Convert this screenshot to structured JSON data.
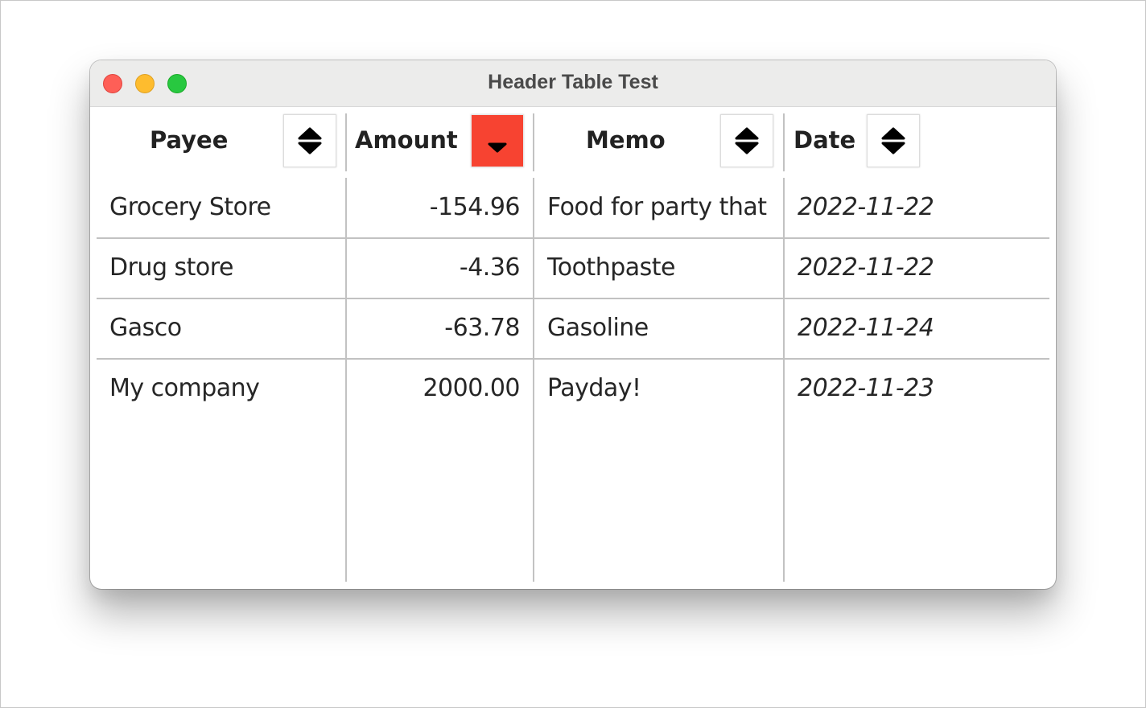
{
  "window": {
    "title": "Header Table Test",
    "controls": [
      "close",
      "minimize",
      "maximize"
    ]
  },
  "table": {
    "columns": [
      {
        "label": "Payee",
        "sort_icon": "sort-both-icon",
        "sort_state": "none"
      },
      {
        "label": "Amount",
        "sort_icon": "sort-descending-icon",
        "sort_state": "descending",
        "active_color": "#f74331"
      },
      {
        "label": "Memo",
        "sort_icon": "sort-both-icon",
        "sort_state": "none"
      },
      {
        "label": "Date",
        "sort_icon": "sort-both-icon",
        "sort_state": "none"
      }
    ],
    "rows": [
      {
        "payee": "Grocery Store",
        "amount": "-154.96",
        "memo": "Food for party that",
        "date": "2022-11-22"
      },
      {
        "payee": "Drug store",
        "amount": "-4.36",
        "memo": "Toothpaste",
        "date": "2022-11-22"
      },
      {
        "payee": "Gasco",
        "amount": "-63.78",
        "memo": "Gasoline",
        "date": "2022-11-24"
      },
      {
        "payee": "My company",
        "amount": "2000.00",
        "memo": "Payday!",
        "date": "2022-11-23"
      }
    ]
  }
}
